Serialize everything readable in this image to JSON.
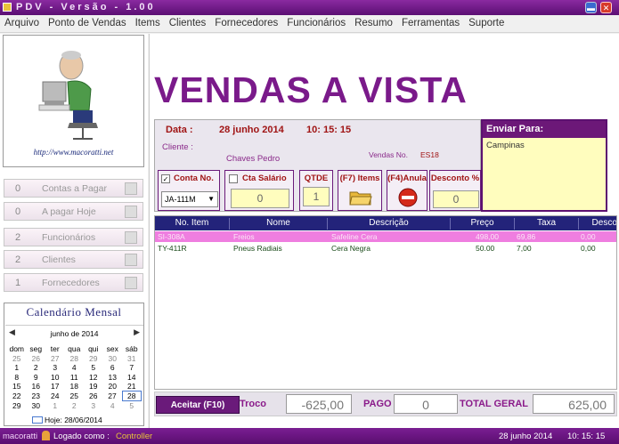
{
  "window": {
    "title": "PDV - Versão - 1.00"
  },
  "menu": [
    "Arquivo",
    "Ponto de Vendas",
    "Items",
    "Clientes",
    "Fornecedores",
    "Funcionários",
    "Resumo",
    "Ferramentas",
    "Suporte"
  ],
  "logo": {
    "url": "http://www.macoratti.net"
  },
  "side_buttons": [
    {
      "count": "0",
      "label": "Contas a Pagar",
      "icon": "clipboard-icon"
    },
    {
      "count": "0",
      "label": "A pagar Hoje",
      "icon": "calculator-icon"
    },
    {
      "count": "2",
      "label": "Funcionários",
      "icon": "people-icon"
    },
    {
      "count": "2",
      "label": "Clientes",
      "icon": "handshake-icon"
    },
    {
      "count": "1",
      "label": "Fornecedores",
      "icon": "person-icon"
    }
  ],
  "calendar": {
    "title": "Calendário Mensal",
    "month": "junho de 2014",
    "weekdays": [
      "dom",
      "seg",
      "ter",
      "qua",
      "qui",
      "sex",
      "sáb"
    ],
    "weeks": [
      [
        "25",
        "26",
        "27",
        "28",
        "29",
        "30",
        "31"
      ],
      [
        "1",
        "2",
        "3",
        "4",
        "5",
        "6",
        "7"
      ],
      [
        "8",
        "9",
        "10",
        "11",
        "12",
        "13",
        "14"
      ],
      [
        "15",
        "16",
        "17",
        "18",
        "19",
        "20",
        "21"
      ],
      [
        "22",
        "23",
        "24",
        "25",
        "26",
        "27",
        "28"
      ],
      [
        "29",
        "30",
        "1",
        "2",
        "3",
        "4",
        "5"
      ]
    ],
    "today_label": "Hoje: 28/06/2014"
  },
  "page_title": "VENDAS A VISTA",
  "header": {
    "data_label": "Data :",
    "date": "28  junho  2014",
    "time": "10: 15: 15",
    "cliente_label": "Cliente :",
    "cliente": "Chaves Pedro",
    "vendas_label": "Vendas No.",
    "vendas_no": "ES18"
  },
  "envio": {
    "title": "Enviar Para:",
    "value": "Campinas"
  },
  "controls": {
    "conta_label": "Conta No.",
    "conta_value": "JA-111M",
    "cta_salario_label": "Cta Salário",
    "cta_salario_value": "0",
    "qtde_label": "QTDE",
    "qtde_value": "1",
    "items_label": "(F7) Items",
    "anula_label": "(F4)Anula",
    "desconto_label": "Desconto %",
    "desconto_value": "0"
  },
  "grid": {
    "columns": [
      "No. Item",
      "Nome",
      "Descrição",
      "Preço",
      "Taxa",
      "Descon"
    ],
    "rows": [
      [
        "SI-308A",
        "Freios",
        "Safeline Cera",
        "498,00",
        "69,86",
        "0,00"
      ],
      [
        "TY-411R",
        "Pneus Radiais",
        "Cera Negra",
        "50.00",
        "7,00",
        "0,00"
      ]
    ]
  },
  "footer": {
    "aceitar_label": "Aceitar (F10)",
    "troco_label": "Troco",
    "troco_value": "-625,00",
    "pago_label": "PAGO",
    "pago_value": "0",
    "total_label": "TOTAL GERAL",
    "total_value": "625,00"
  },
  "status": {
    "user": "macoratti",
    "logged_label": "Logado como :",
    "role": "Controller",
    "date": "28  junho  2014",
    "time": "10: 15: 15"
  },
  "colors": {
    "accent": "#6c1878",
    "title": "#7a1a8a",
    "label_red": "#a01414",
    "grid_header": "#23237a",
    "selected_row": "#ef7ee0",
    "field_yellow": "#fffdbe"
  }
}
